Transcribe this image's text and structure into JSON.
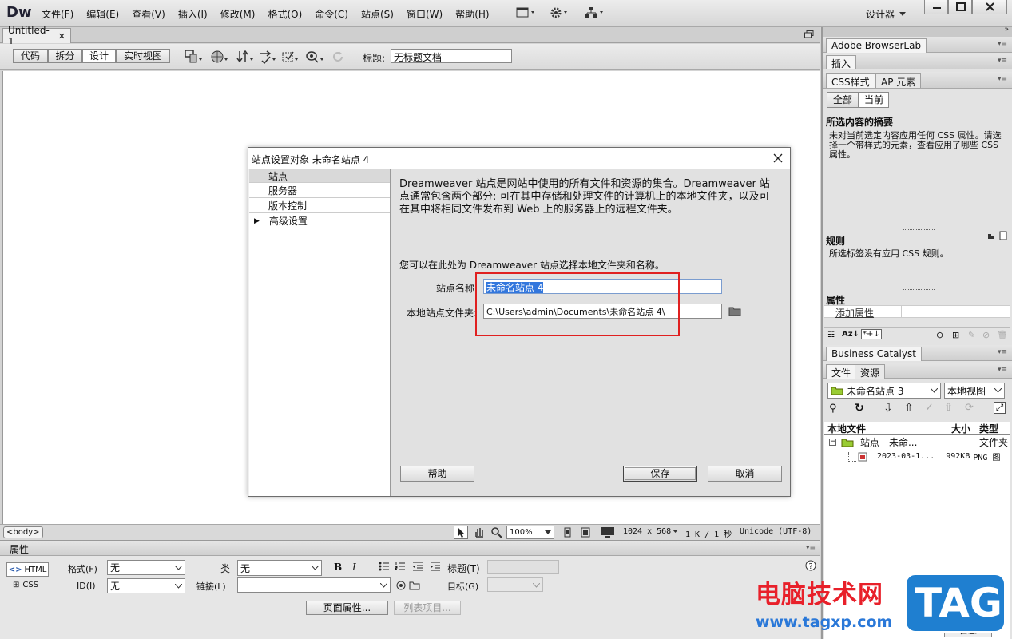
{
  "app": {
    "logo": "Dw",
    "menu": [
      "文件(F)",
      "编辑(E)",
      "查看(V)",
      "插入(I)",
      "修改(M)",
      "格式(O)",
      "命令(C)",
      "站点(S)",
      "窗口(W)",
      "帮助(H)"
    ],
    "workspace": "设计器"
  },
  "document": {
    "tab": "Untitled-1",
    "views": [
      "代码",
      "拆分",
      "设计",
      "实时视图"
    ],
    "title_label": "标题:",
    "title_value": "无标题文档"
  },
  "dialog": {
    "title": "站点设置对象 未命名站点 4",
    "nav": [
      "站点",
      "服务器",
      "版本控制",
      "高级设置"
    ],
    "description": "Dreamweaver 站点是网站中使用的所有文件和资源的集合。Dreamweaver 站点通常包含两个部分: 可在其中存储和处理文件的计算机上的本地文件夹，以及可在其中将相同文件发布到 Web 上的服务器上的远程文件夹。",
    "prompt": "您可以在此处为 Dreamweaver 站点选择本地文件夹和名称。",
    "site_name_label": "站点名称:",
    "site_name_value": "未命名站点 4",
    "local_folder_label": "本地站点文件夹:",
    "local_folder_value": "C:\\Users\\admin\\Documents\\未命名站点 4\\",
    "help": "帮助",
    "save": "保存",
    "cancel": "取消"
  },
  "statusbar": {
    "tag": "<body>",
    "zoom": "100%",
    "size": "1024 x 568",
    "speed": "1 K / 1 秒",
    "encoding": "Unicode (UTF-8)"
  },
  "properties": {
    "header": "属性",
    "html_btn": "HTML",
    "css_btn": "CSS",
    "format_label": "格式(F)",
    "format_value": "无",
    "class_label": "类",
    "class_value": "无",
    "id_label": "ID(I)",
    "id_value": "无",
    "link_label": "链接(L)",
    "title_label": "标题(T)",
    "target_label": "目标(G)",
    "page_props": "页面属性...",
    "list_item": "列表项目..."
  },
  "right_panel": {
    "browserlab": "Adobe BrowserLab",
    "insert": "插入",
    "css_tab": "CSS样式",
    "ap_tab": "AP 元素",
    "all": "全部",
    "current": "当前",
    "summary_title": "所选内容的摘要",
    "summary_text": "未对当前选定内容应用任何 CSS 属性。请选择一个带样式的元素，查看应用了哪些 CSS 属性。",
    "rules_title": "规则",
    "rules_text": "所选标签没有应用 CSS 规则。",
    "props_title": "属性",
    "add_prop": "添加属性",
    "business": "Business Catalyst",
    "files_tab": "文件",
    "assets_tab": "资源",
    "site_select": "未命名站点 3",
    "view_select": "本地视图",
    "col_local": "本地文件",
    "col_size": "大小",
    "col_type": "类型",
    "tree_root": "站点 - 未命...",
    "tree_root_type": "文件夹",
    "file_name": "2023-03-1...",
    "file_size": "992KB",
    "file_type": "PNG 图",
    "log": "日志"
  },
  "watermark": {
    "text": "电脑技术网",
    "url": "www.tagxp.com",
    "badge": "TAG"
  }
}
